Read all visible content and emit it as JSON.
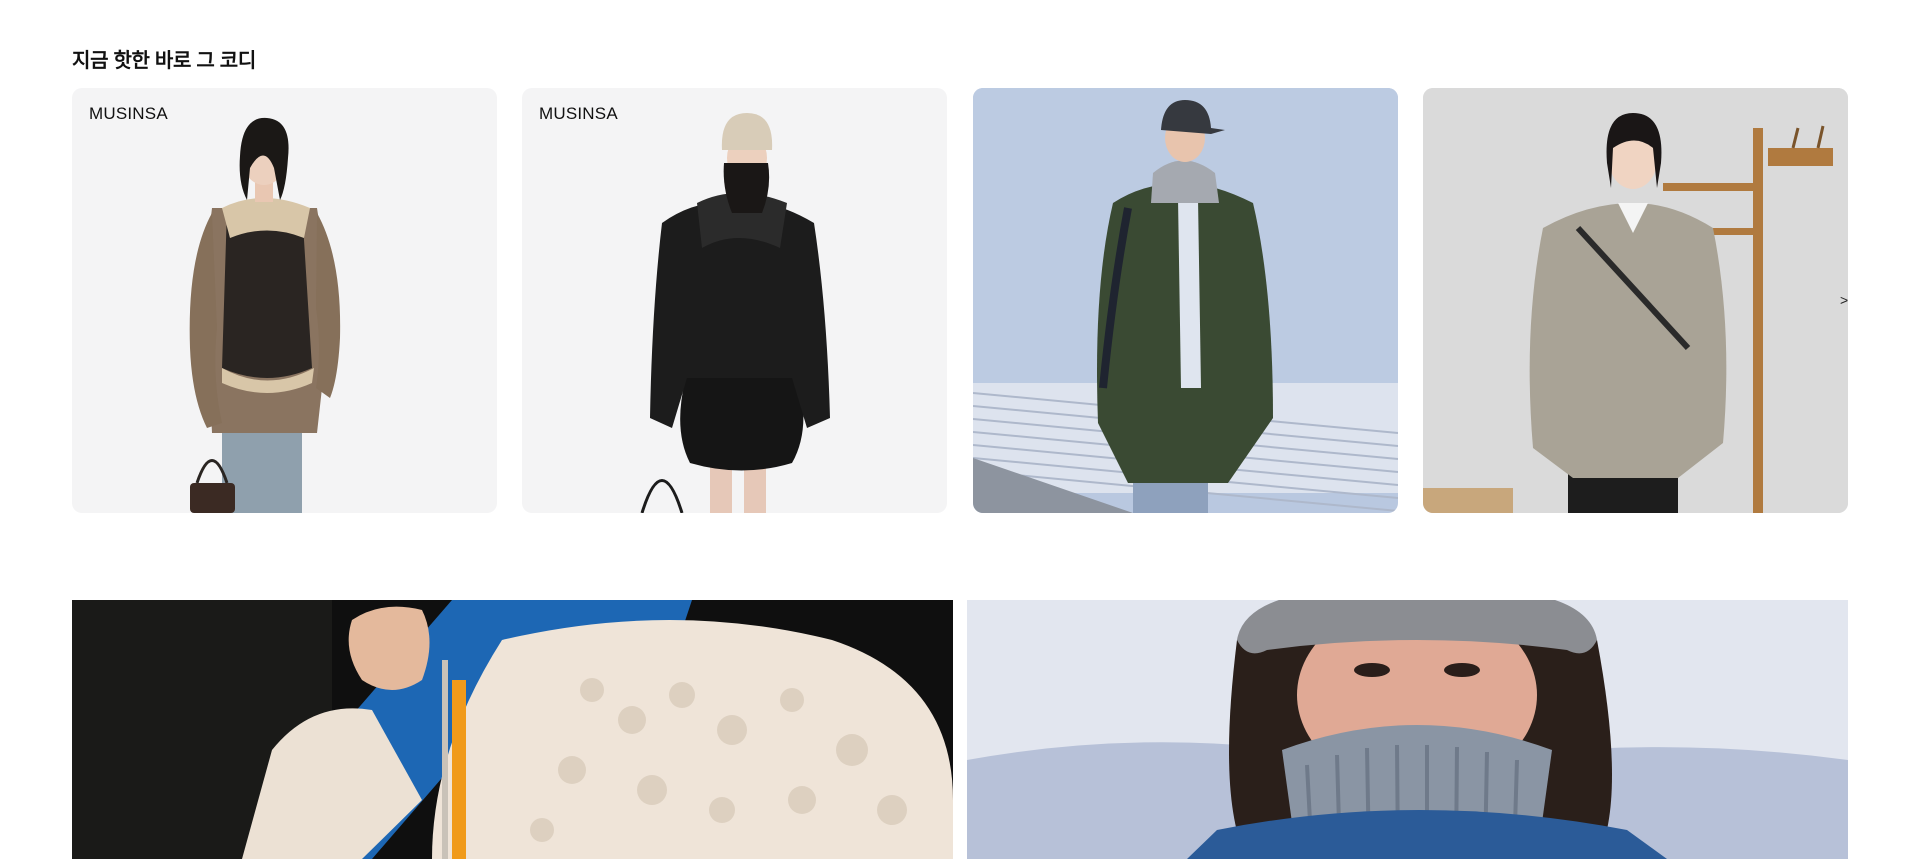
{
  "section": {
    "title": "지금 핫한 바로 그 코디"
  },
  "cards": [
    {
      "label": "MUSINSA"
    },
    {
      "label": "MUSINSA"
    },
    {
      "label": ""
    },
    {
      "label": ""
    }
  ],
  "carousel": {
    "next_glyph": ">"
  },
  "icons": {
    "next": "chevron-right-icon"
  },
  "colors": {
    "card_bg": "#f4f4f5",
    "title": "#111111"
  }
}
